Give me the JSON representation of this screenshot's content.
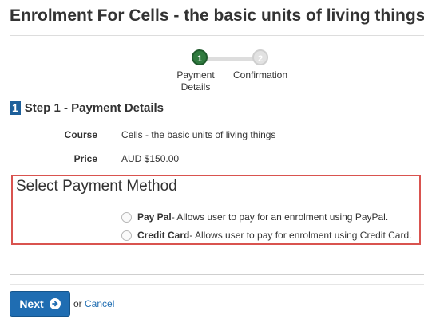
{
  "page": {
    "title": "Enrolment For Cells - the basic units of living things"
  },
  "stepper": {
    "steps": [
      {
        "number": "1",
        "label_line1": "Payment",
        "label_line2": "Details",
        "state": "active"
      },
      {
        "number": "2",
        "label_line1": "Confirmation",
        "label_line2": "",
        "state": "pending"
      }
    ]
  },
  "step_section": {
    "badge": "1",
    "title": "Step 1 - Payment Details"
  },
  "details": {
    "course_label": "Course",
    "course_value": "Cells - the basic units of living things",
    "price_label": "Price",
    "price_value": "AUD $150.00"
  },
  "payment": {
    "heading": "Select Payment Method",
    "options": [
      {
        "name": "Pay Pal",
        "description": " - Allows user to pay for an enrolment using PayPal.",
        "selected": false
      },
      {
        "name": "Credit Card",
        "description": " - Allows user to pay for enrolment using Credit Card.",
        "selected": false
      }
    ]
  },
  "actions": {
    "next_label": "Next",
    "or_text": "or",
    "cancel_label": "Cancel"
  },
  "colors": {
    "highlight_border": "#d9534f",
    "primary_button": "#1f6db2",
    "active_step": "#2f7a3e",
    "step_badge": "#1d5f9a"
  },
  "icons": {
    "next": "circle-arrow-right-icon"
  }
}
